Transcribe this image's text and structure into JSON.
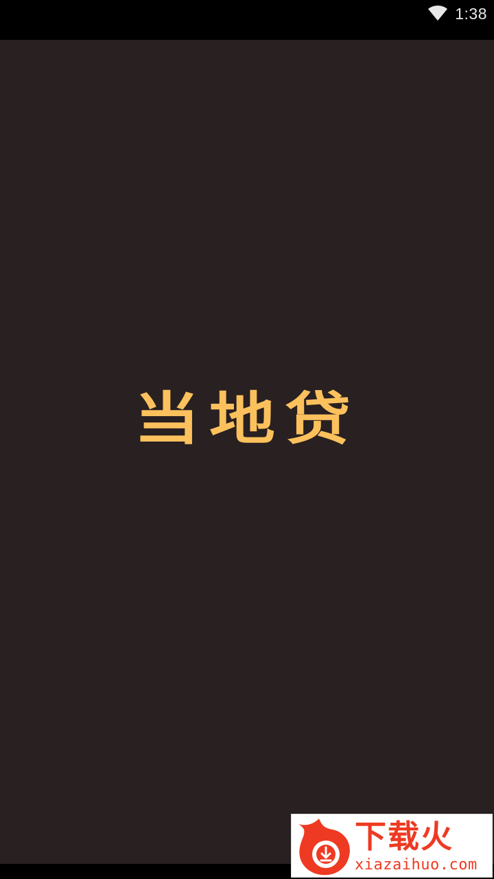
{
  "status_bar": {
    "time": "1:38",
    "wifi_icon": "wifi-icon"
  },
  "splash": {
    "app_name": "当地贷",
    "background_color": "#282021",
    "logo_color": "#fcc15d"
  },
  "watermark": {
    "logo_icon": "flame-download-icon",
    "title": "下载火",
    "url": "xiazaihuo.com",
    "brand_color": "#ee3a22"
  }
}
